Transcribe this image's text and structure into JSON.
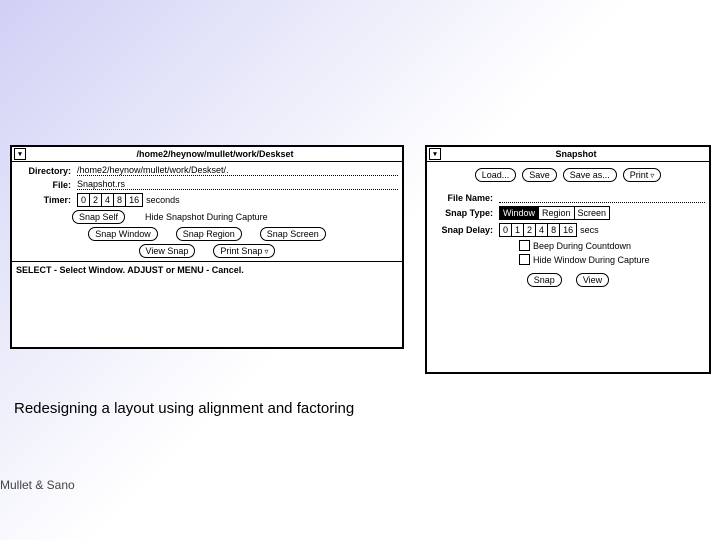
{
  "left": {
    "title": "/home2/heynow/mullet/work/Deskset",
    "directory_label": "Directory:",
    "directory_value": "/home2/heynow/mullet/work/Deskset/.",
    "file_label": "File:",
    "file_value": "Snapshot.rs",
    "timer_label": "Timer:",
    "timer_options": [
      "0",
      "2",
      "4",
      "8",
      "16"
    ],
    "timer_suffix": "seconds",
    "snap_self_label": "Snap Self",
    "hide_label": "Hide Snapshot During Capture",
    "snap_window": "Snap Window",
    "snap_region": "Snap Region",
    "snap_screen": "Snap Screen",
    "view_snap": "View Snap",
    "print_snap": "Print Snap",
    "status": "SELECT - Select Window. ADJUST or MENU - Cancel."
  },
  "right": {
    "title": "Snapshot",
    "load": "Load...",
    "save": "Save",
    "save_as": "Save as...",
    "print": "Print",
    "filename_label": "File Name:",
    "filename_value": "",
    "snaptype_label": "Snap Type:",
    "snaptype_options": [
      "Window",
      "Region",
      "Screen"
    ],
    "snapdelay_label": "Snap Delay:",
    "snapdelay_options": [
      "0",
      "1",
      "2",
      "4",
      "8",
      "16"
    ],
    "snapdelay_suffix": "secs",
    "beep_label": "Beep During Countdown",
    "hide_label": "Hide Window During Capture",
    "snap": "Snap",
    "view": "View"
  },
  "caption": "Redesigning a layout using alignment and factoring",
  "credit": "Mullet & Sano"
}
